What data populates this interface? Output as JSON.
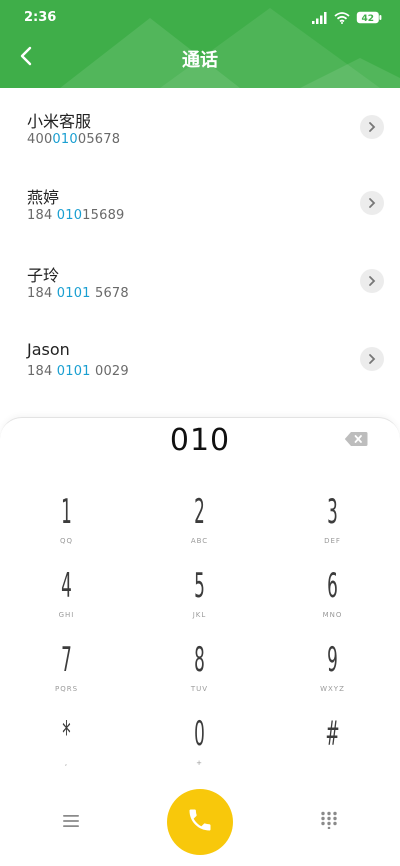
{
  "status_bar": {
    "time": "2:36",
    "battery": "42"
  },
  "header": {
    "title": "通话",
    "background_color": "#3fae49"
  },
  "contacts": [
    {
      "name": "小米客服",
      "number_pre": "400",
      "number_match": "010",
      "number_post": "05678"
    },
    {
      "name": "燕婷",
      "number_pre": "184 ",
      "number_match": "010",
      "number_post": "15689"
    },
    {
      "name": "子玲",
      "number_pre": "184 ",
      "number_match": "0101",
      "number_post": " 5678"
    },
    {
      "name": "Jason",
      "number_pre": "184 ",
      "number_match": "0101",
      "number_post": " 0029"
    }
  ],
  "dialer": {
    "input": "010",
    "keys": [
      {
        "digit": "1",
        "letters": "QQ"
      },
      {
        "digit": "2",
        "letters": "ABC"
      },
      {
        "digit": "3",
        "letters": "DEF"
      },
      {
        "digit": "4",
        "letters": "GHI"
      },
      {
        "digit": "5",
        "letters": "JKL"
      },
      {
        "digit": "6",
        "letters": "MNO"
      },
      {
        "digit": "7",
        "letters": "PQRS"
      },
      {
        "digit": "8",
        "letters": "TUV"
      },
      {
        "digit": "9",
        "letters": "WXYZ"
      },
      {
        "digit": "*",
        "letters": ","
      },
      {
        "digit": "0",
        "letters": "+"
      },
      {
        "digit": "#",
        "letters": ""
      }
    ],
    "call_button_color": "#f8c80b",
    "highlight_color": "#1a9fd1"
  },
  "icons": {
    "back": "back-arrow-icon",
    "menu": "menu-icon",
    "call": "phone-icon",
    "keypad": "keypad-icon",
    "backspace": "backspace-icon"
  }
}
